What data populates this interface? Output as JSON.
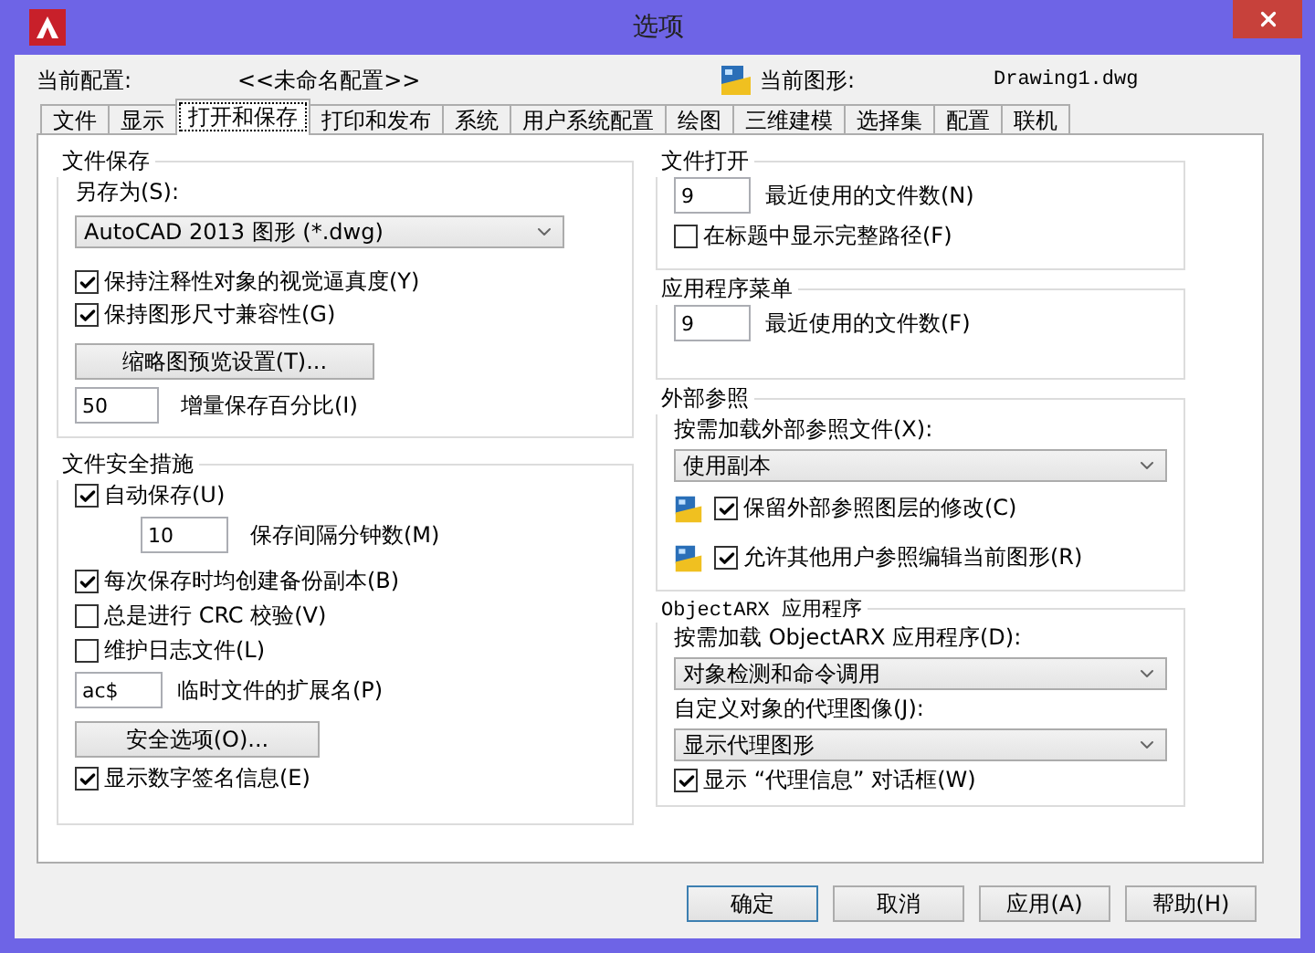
{
  "window": {
    "title": "选项"
  },
  "header": {
    "profile_label": "当前配置:",
    "profile_value": "<<未命名配置>>",
    "drawing_label": "当前图形:",
    "drawing_value": "Drawing1.dwg"
  },
  "tabs": [
    {
      "label": "文件",
      "selected": false
    },
    {
      "label": "显示",
      "selected": false
    },
    {
      "label": "打开和保存",
      "selected": true
    },
    {
      "label": "打印和发布",
      "selected": false
    },
    {
      "label": "系统",
      "selected": false
    },
    {
      "label": "用户系统配置",
      "selected": false
    },
    {
      "label": "绘图",
      "selected": false
    },
    {
      "label": "三维建模",
      "selected": false
    },
    {
      "label": "选择集",
      "selected": false
    },
    {
      "label": "配置",
      "selected": false
    },
    {
      "label": "联机",
      "selected": false
    }
  ],
  "file_save": {
    "title": "文件保存",
    "save_as_label": "另存为(S):",
    "save_as_value": "AutoCAD 2013 图形 (*.dwg)",
    "checkboxes": [
      {
        "label": "保持注释性对象的视觉逼真度(Y)",
        "checked": true
      },
      {
        "label": "保持图形尺寸兼容性(G)",
        "checked": true
      }
    ],
    "thumbnail_button": "缩略图预览设置(T)...",
    "incremental_value": "50",
    "incremental_label": "增量保存百分比(I)"
  },
  "file_safety": {
    "title": "文件安全措施",
    "autosave": {
      "label": "自动保存(U)",
      "checked": true
    },
    "interval_value": "10",
    "interval_label": "保存间隔分钟数(M)",
    "checkboxes": [
      {
        "label": "每次保存时均创建备份副本(B)",
        "checked": true
      },
      {
        "label": "总是进行 CRC 校验(V)",
        "checked": false
      },
      {
        "label": "维护日志文件(L)",
        "checked": false
      }
    ],
    "temp_value": "ac$",
    "temp_label": "临时文件的扩展名(P)",
    "security_button": "安全选项(O)...",
    "signature": {
      "label": "显示数字签名信息(E)",
      "checked": true
    }
  },
  "file_open": {
    "title": "文件打开",
    "recent_value": "9",
    "recent_label": "最近使用的文件数(N)",
    "full_path": {
      "label": "在标题中显示完整路径(F)",
      "checked": false
    }
  },
  "app_menu": {
    "title": "应用程序菜单",
    "recent_value": "9",
    "recent_label": "最近使用的文件数(F)"
  },
  "xref": {
    "title": "外部参照",
    "load_label": "按需加载外部参照文件(X):",
    "load_value": "使用副本",
    "options": [
      {
        "label": "保留外部参照图层的修改(C)",
        "checked": true
      },
      {
        "label": "允许其他用户参照编辑当前图形(R)",
        "checked": true
      }
    ]
  },
  "objectarx": {
    "title": "ObjectARX 应用程序",
    "load_label": "按需加载 ObjectARX 应用程序(D):",
    "load_value": "对象检测和命令调用",
    "proxy_label": "自定义对象的代理图像(J):",
    "proxy_value": "显示代理图形",
    "proxy_dialog": {
      "label": "显示 “代理信息” 对话框(W)",
      "checked": true
    }
  },
  "buttons": [
    {
      "label": "确定",
      "default": true
    },
    {
      "label": "取消",
      "default": false
    },
    {
      "label": "应用(A)",
      "default": false
    },
    {
      "label": "帮助(H)",
      "default": false
    }
  ]
}
